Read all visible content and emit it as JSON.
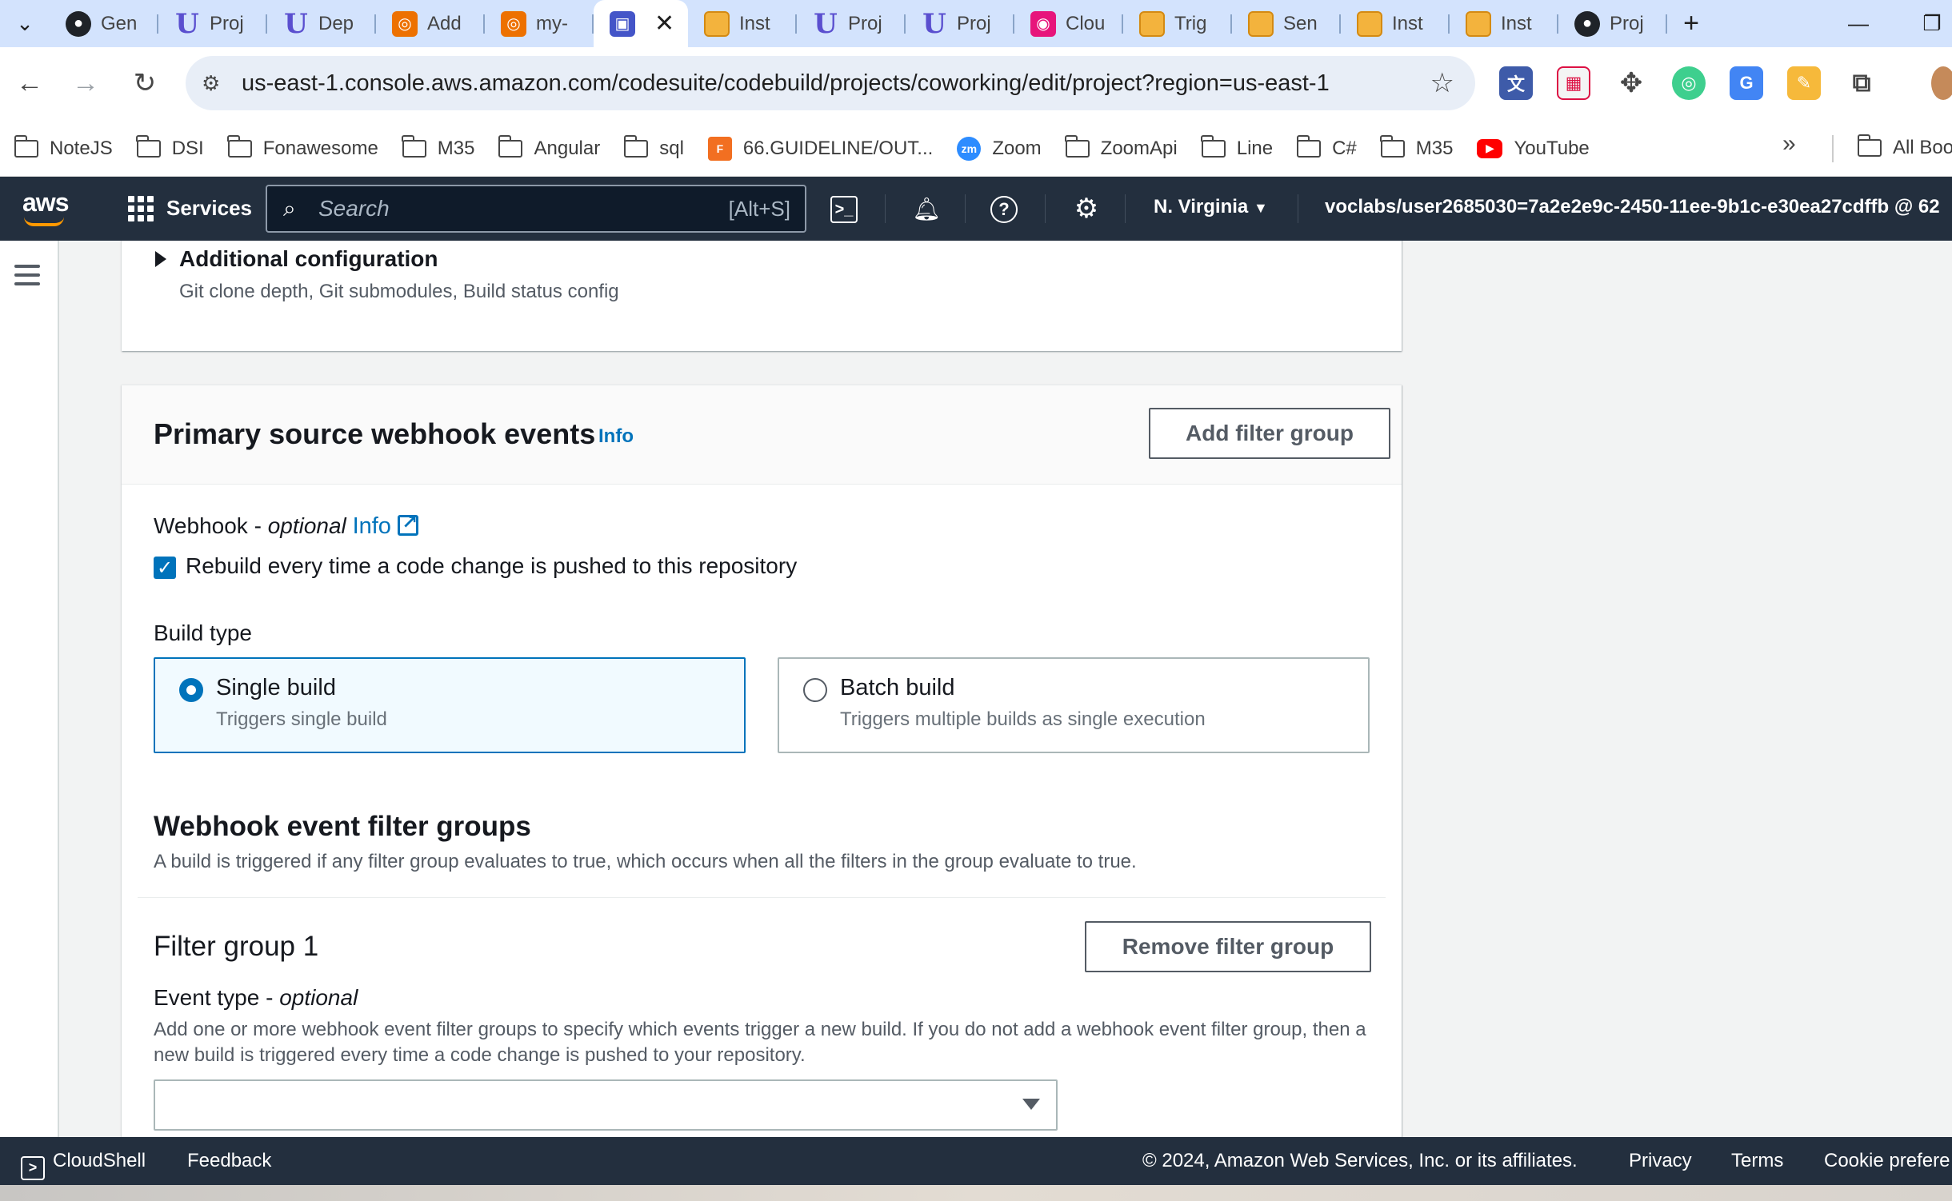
{
  "browser": {
    "tabs": [
      {
        "label": "Gen",
        "icon": "github-icon"
      },
      {
        "label": "Proj",
        "icon": "udacity-icon"
      },
      {
        "label": "Dep",
        "icon": "udacity-icon"
      },
      {
        "label": "Add",
        "icon": "aws-service-icon"
      },
      {
        "label": "my-",
        "icon": "aws-service-icon"
      },
      {
        "label": "",
        "icon": "codebuild-icon",
        "active": true
      },
      {
        "label": "Inst",
        "icon": "aws-cube-icon"
      },
      {
        "label": "Proj",
        "icon": "udacity-icon"
      },
      {
        "label": "Proj",
        "icon": "udacity-icon"
      },
      {
        "label": "Clou",
        "icon": "cloudformation-icon"
      },
      {
        "label": "Trig",
        "icon": "aws-cube-icon"
      },
      {
        "label": "Sen",
        "icon": "aws-cube-icon"
      },
      {
        "label": "Inst",
        "icon": "aws-cube-icon"
      },
      {
        "label": "Inst",
        "icon": "aws-cube-icon"
      },
      {
        "label": "Proj",
        "icon": "github-icon"
      }
    ],
    "url": "us-east-1.console.aws.amazon.com/codesuite/codebuild/projects/coworking/edit/project?region=us-east-1",
    "bookmarks": [
      {
        "label": "NoteJS",
        "type": "folder"
      },
      {
        "label": "DSI",
        "type": "folder"
      },
      {
        "label": "Fonawesome",
        "type": "folder"
      },
      {
        "label": "M35",
        "type": "folder"
      },
      {
        "label": "Angular",
        "type": "folder"
      },
      {
        "label": "sql",
        "type": "folder"
      },
      {
        "label": "66.GUIDELINE/OUT...",
        "type": "fpt"
      },
      {
        "label": "Zoom",
        "type": "zoom"
      },
      {
        "label": "ZoomApi",
        "type": "folder"
      },
      {
        "label": "Line",
        "type": "folder"
      },
      {
        "label": "C#",
        "type": "folder"
      },
      {
        "label": "M35",
        "type": "folder"
      },
      {
        "label": "YouTube",
        "type": "youtube"
      }
    ],
    "bookmarks_more": "»",
    "all_bookmarks": "All Boo"
  },
  "aws_header": {
    "logo": "aws",
    "services_label": "Services",
    "search_placeholder": "Search",
    "search_shortcut": "[Alt+S]",
    "region": "N. Virginia",
    "account": "voclabs/user2685030=7a2e2e9c-2450-11ee-9b1c-e30ea27cdffb @ 62"
  },
  "additional_config": {
    "title": "Additional configuration",
    "description": "Git clone depth, Git submodules, Build status config"
  },
  "webhook_panel": {
    "title": "Primary source webhook events",
    "info": "Info",
    "add_filter_group": "Add filter group",
    "webhook_label": "Webhook",
    "webhook_optional": "optional",
    "webhook_info": "Info",
    "rebuild_checkbox": "Rebuild every time a code change is pushed to this repository",
    "rebuild_checked": true,
    "build_type_label": "Build type",
    "build_types": [
      {
        "title": "Single build",
        "desc": "Triggers single build",
        "selected": true
      },
      {
        "title": "Batch build",
        "desc": "Triggers multiple builds as single execution",
        "selected": false
      }
    ],
    "filter_groups_title": "Webhook event filter groups",
    "filter_groups_desc": "A build is triggered if any filter group evaluates to true, which occurs when all the filters in the group evaluate to true.",
    "filter_group_1": {
      "title": "Filter group 1",
      "remove_button": "Remove filter group",
      "event_type_label": "Event type",
      "event_type_optional": "optional",
      "event_type_desc": "Add one or more webhook event filter groups to specify which events trigger a new build. If you do not add a webhook event filter group, then a new build is triggered every time a code change is pushed to your repository.",
      "event_type_value": ""
    }
  },
  "footer": {
    "cloudshell": "CloudShell",
    "feedback": "Feedback",
    "copyright": "© 2024, Amazon Web Services, Inc. or its affiliates.",
    "privacy": "Privacy",
    "terms": "Terms",
    "cookies": "Cookie prefere"
  },
  "colors": {
    "aws_nav": "#232f3e",
    "link": "#0073bb",
    "chrome_tabstrip": "#d3e3fd"
  }
}
